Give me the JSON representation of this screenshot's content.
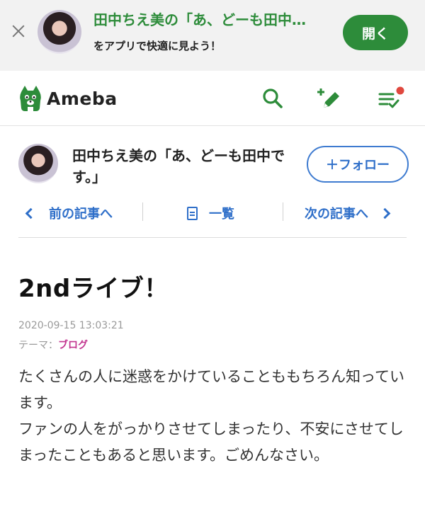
{
  "banner": {
    "title": "田中ちえ美の「あ、どーも田中…",
    "subtitle": "をアプリで快適に見よう！",
    "open_label": "開く"
  },
  "header": {
    "logo_text": "Ameba",
    "icons": [
      "search-icon",
      "write-icon",
      "notification-list-icon"
    ]
  },
  "blog": {
    "title": "田中ちえ美の「あ、どーも田中です。」",
    "follow_label": "＋フォロー"
  },
  "nav": {
    "prev_label": "前の記事へ",
    "list_label": "一覧",
    "next_label": "次の記事へ"
  },
  "entry": {
    "title": "2ndライブ！",
    "date": "2020-09-15 13:03:21",
    "theme_label": "テーマ：",
    "theme_value": "ブログ",
    "paragraphs": [
      "たくさんの人に迷惑をかけていることももちろん知っています。",
      "ファンの人をがっかりさせてしまったり、不安にさせてしまったこともあると思います。ごめんなさい。"
    ]
  },
  "colors": {
    "brand_green": "#2d8c3a",
    "link_blue": "#2f6fc9",
    "theme_pink": "#c2348f",
    "notification_red": "#e0483e"
  }
}
